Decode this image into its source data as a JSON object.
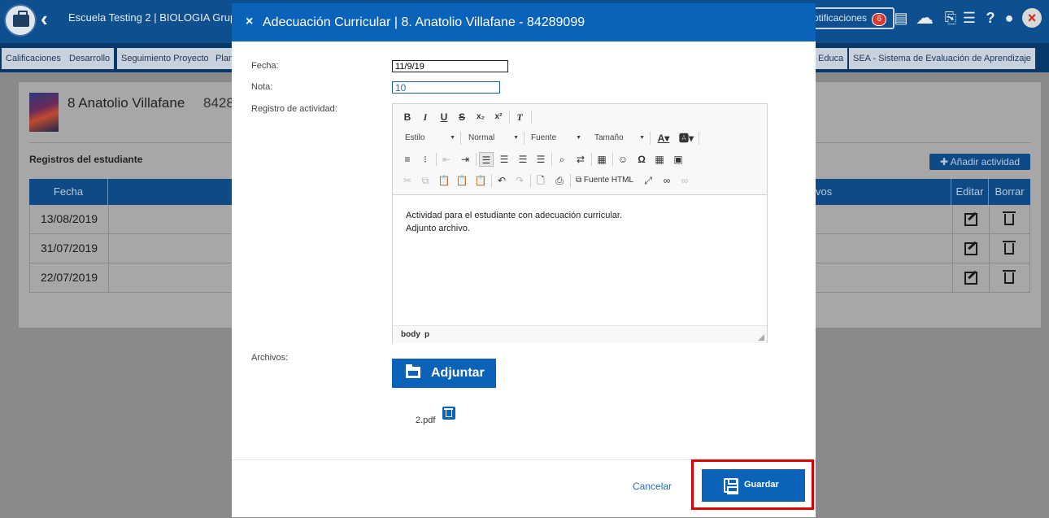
{
  "app": {
    "title": "Escuela Testing 2 | BIOLOGIA Grupo",
    "notifications_label": "otificaciones",
    "notifications_count": "6"
  },
  "tabs": [
    {
      "label": "Calificaciones"
    },
    {
      "label": "Desarrollo"
    },
    {
      "label": "Seguimiento Proyecto"
    },
    {
      "label": "Plan"
    },
    {
      "label": "Educa"
    },
    {
      "label": "SEA - Sistema de Evaluación de Aprendizaje"
    }
  ],
  "student": {
    "name": "8 Anatolio Villafane",
    "id_partial": "8428"
  },
  "records": {
    "title": "Registros del estudiante",
    "add_button": "✚ Añadir actividad",
    "columns": {
      "date": "Fecha",
      "objectives_partial": "vos",
      "edit": "Editar",
      "delete": "Borrar"
    },
    "rows": [
      {
        "date": "13/08/2019"
      },
      {
        "date": "31/07/2019"
      },
      {
        "date": "22/07/2019"
      }
    ]
  },
  "modal": {
    "close_glyph": "×",
    "title": "Adecuación Curricular | 8. Anatolio Villafane - 84289099",
    "fecha_label": "Fecha:",
    "fecha_value": "11/9/19",
    "nota_label": "Nota:",
    "nota_value": "10",
    "registro_label": "Registro de actividad:",
    "archivos_label": "Archivos:",
    "attach_button": "Adjuntar",
    "file_name": "2.pdf",
    "cancel_button": "Cancelar",
    "save_button": "Guardar"
  },
  "editor": {
    "combo_style": "Estilo",
    "combo_format": "Normal",
    "combo_font": "Fuente",
    "combo_size": "Tamaño",
    "source_button": "Fuente HTML",
    "content_line1": "Actividad para el estudiante con adecuación curricular.",
    "content_line2": "Adjunto archivo.",
    "path_body": "body",
    "path_p": "p"
  },
  "colors": {
    "header_blue": "#0a63b8",
    "topbar_blue": "#0d4f8f",
    "highlight_red": "#e00000"
  }
}
